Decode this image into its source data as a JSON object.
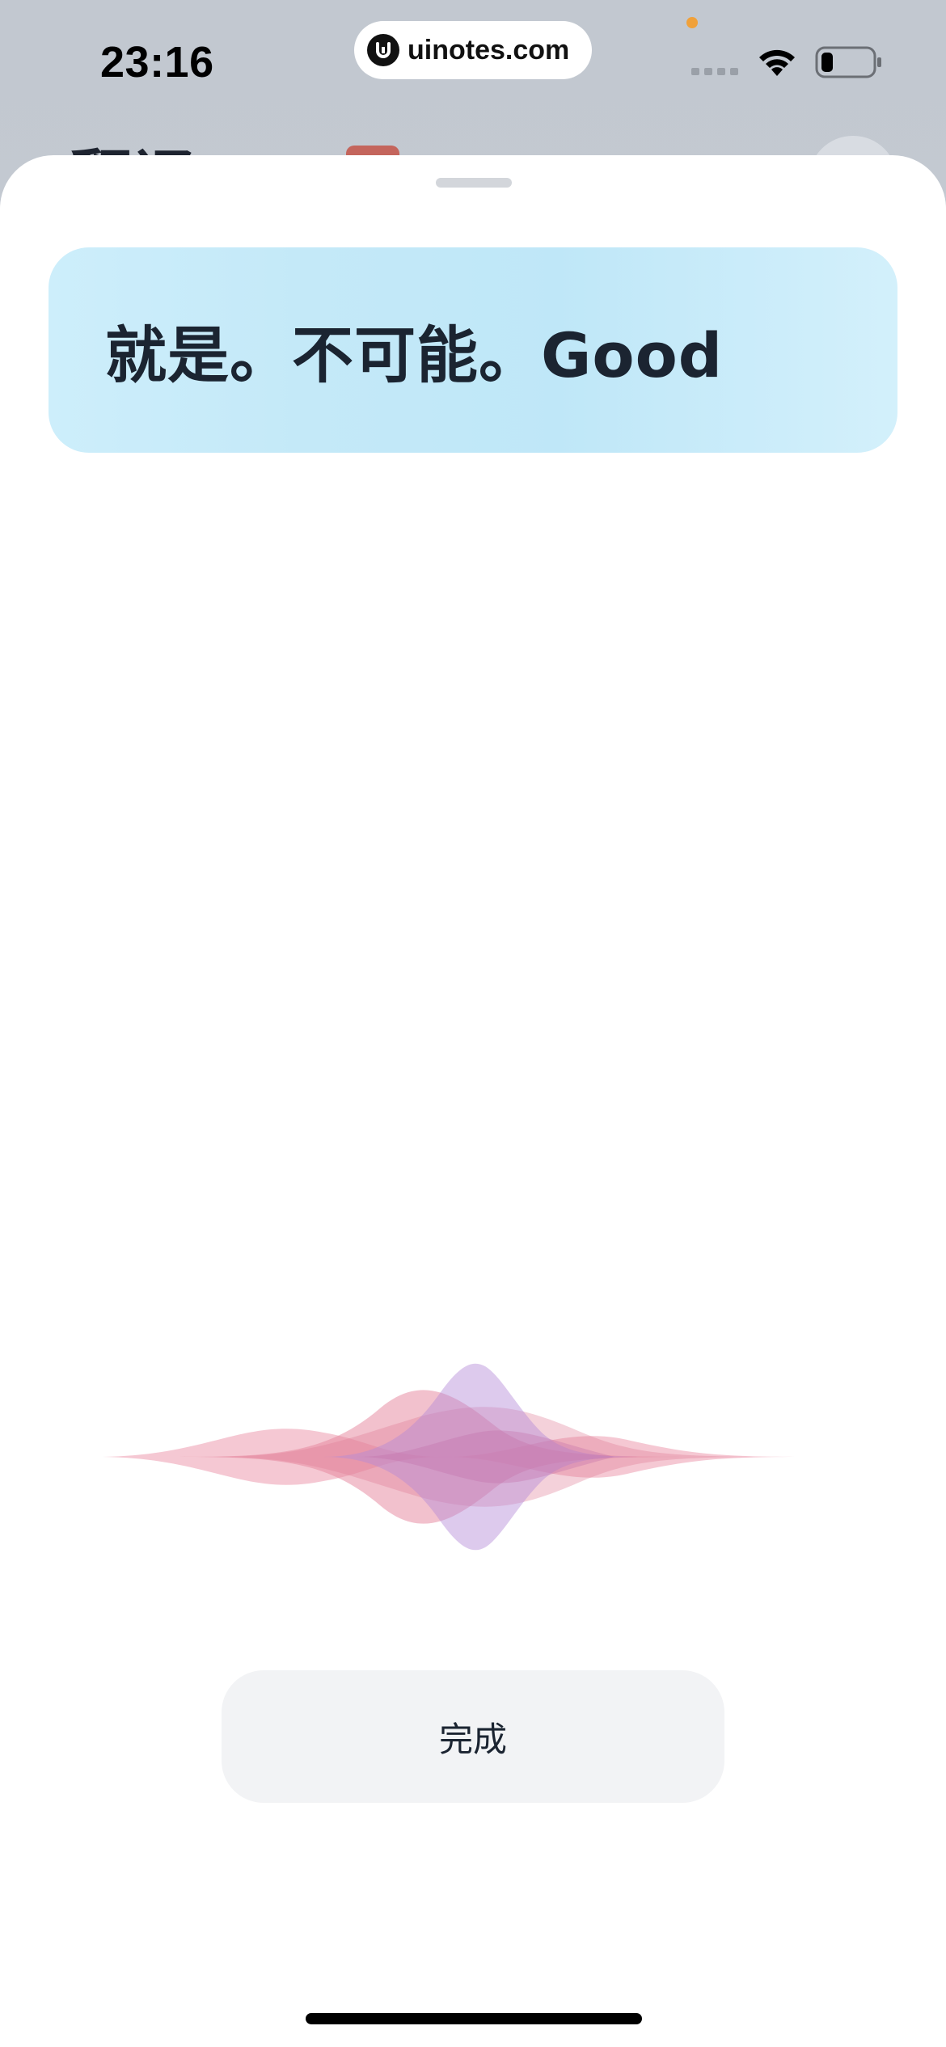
{
  "status_bar": {
    "time": "23:16",
    "site": "uinotes.com",
    "icons": [
      "cellular-icon",
      "wifi-icon",
      "battery-icon"
    ]
  },
  "background": {
    "title": "翻译"
  },
  "sheet": {
    "transcript": "就是。不可能。Good",
    "done_label": "完成"
  },
  "colors": {
    "card_bg": "#c4e9f8",
    "text": "#1b2431",
    "wave_pink": "#e07a95",
    "wave_purple": "#b48ad6",
    "button_bg": "#f2f3f5"
  }
}
